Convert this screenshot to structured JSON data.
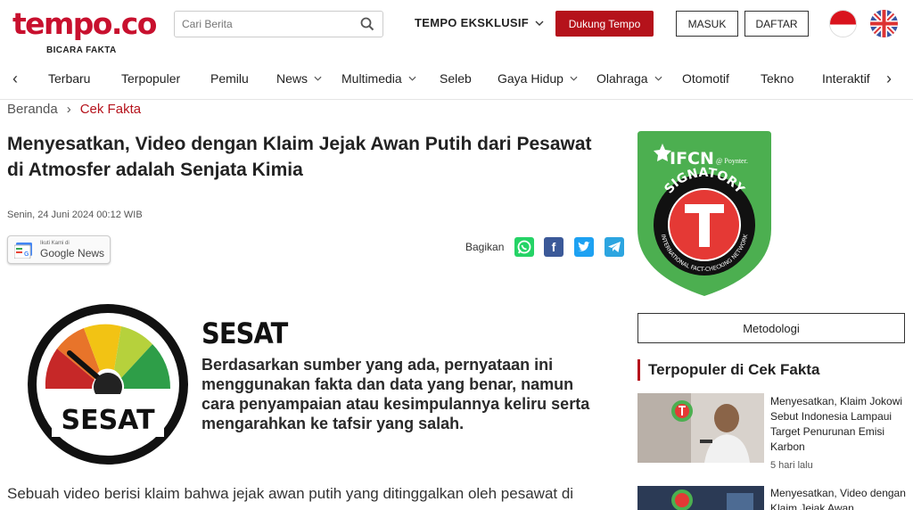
{
  "header": {
    "logo_text": "tempo.co",
    "tagline": "BICARA FAKTA",
    "search_placeholder": "Cari Berita",
    "eksklusif": "TEMPO EKSKLUSIF",
    "dukung": "Dukung Tempo",
    "masuk": "MASUK",
    "daftar": "DAFTAR"
  },
  "nav": {
    "items": [
      "Terbaru",
      "Terpopuler",
      "Pemilu",
      "News",
      "Multimedia",
      "Seleb",
      "Gaya Hidup",
      "Olahraga",
      "Otomotif",
      "Tekno",
      "Interaktif"
    ]
  },
  "breadcrumb": {
    "home": "Beranda",
    "separator": "›",
    "current": "Cek Fakta"
  },
  "article": {
    "title": "Menyesatkan, Video dengan Klaim Jejak Awan Putih dari Pesawat di Atmosfer adalah Senjata Kimia",
    "date": "Senin, 24 Juni 2024 00:12 WIB",
    "gnews_small": "Ikuti Kami di",
    "gnews_big": "Google News",
    "share_label": "Bagikan",
    "verdict_title": "SESAT",
    "verdict_gauge_label": "SESAT",
    "verdict_desc": "Berdasarkan sumber yang ada, pernyataan ini menggunakan fakta dan data yang benar, namun cara penyampaian atau kesimpulannya keliru serta mengarahkan ke tafsir yang salah.",
    "body_start": "Sebuah video berisi klaim bahwa jejak awan putih yang ditinggalkan oleh pesawat di"
  },
  "sidebar": {
    "ifcn_text": "IFCN",
    "ifcn_sub": "@ Poynter.",
    "ifcn_signatory": "SIGNATORY",
    "ifcn_network": "INTERNATIONAL FACT-CHECKING NETWORK",
    "metodologi": "Metodologi",
    "popular_heading": "Terpopuler di Cek Fakta",
    "popular": [
      {
        "title": "Menyesatkan, Klaim Jokowi Sebut Indonesia Lampaui Target Penurunan Emisi Karbon",
        "time": "5 hari lalu"
      },
      {
        "title": "Menyesatkan, Video dengan Klaim Jejak Awan",
        "time": ""
      }
    ]
  },
  "colors": {
    "brand_red": "#c8102e",
    "button_red": "#b5121b",
    "ifcn_green": "#4caf50"
  }
}
